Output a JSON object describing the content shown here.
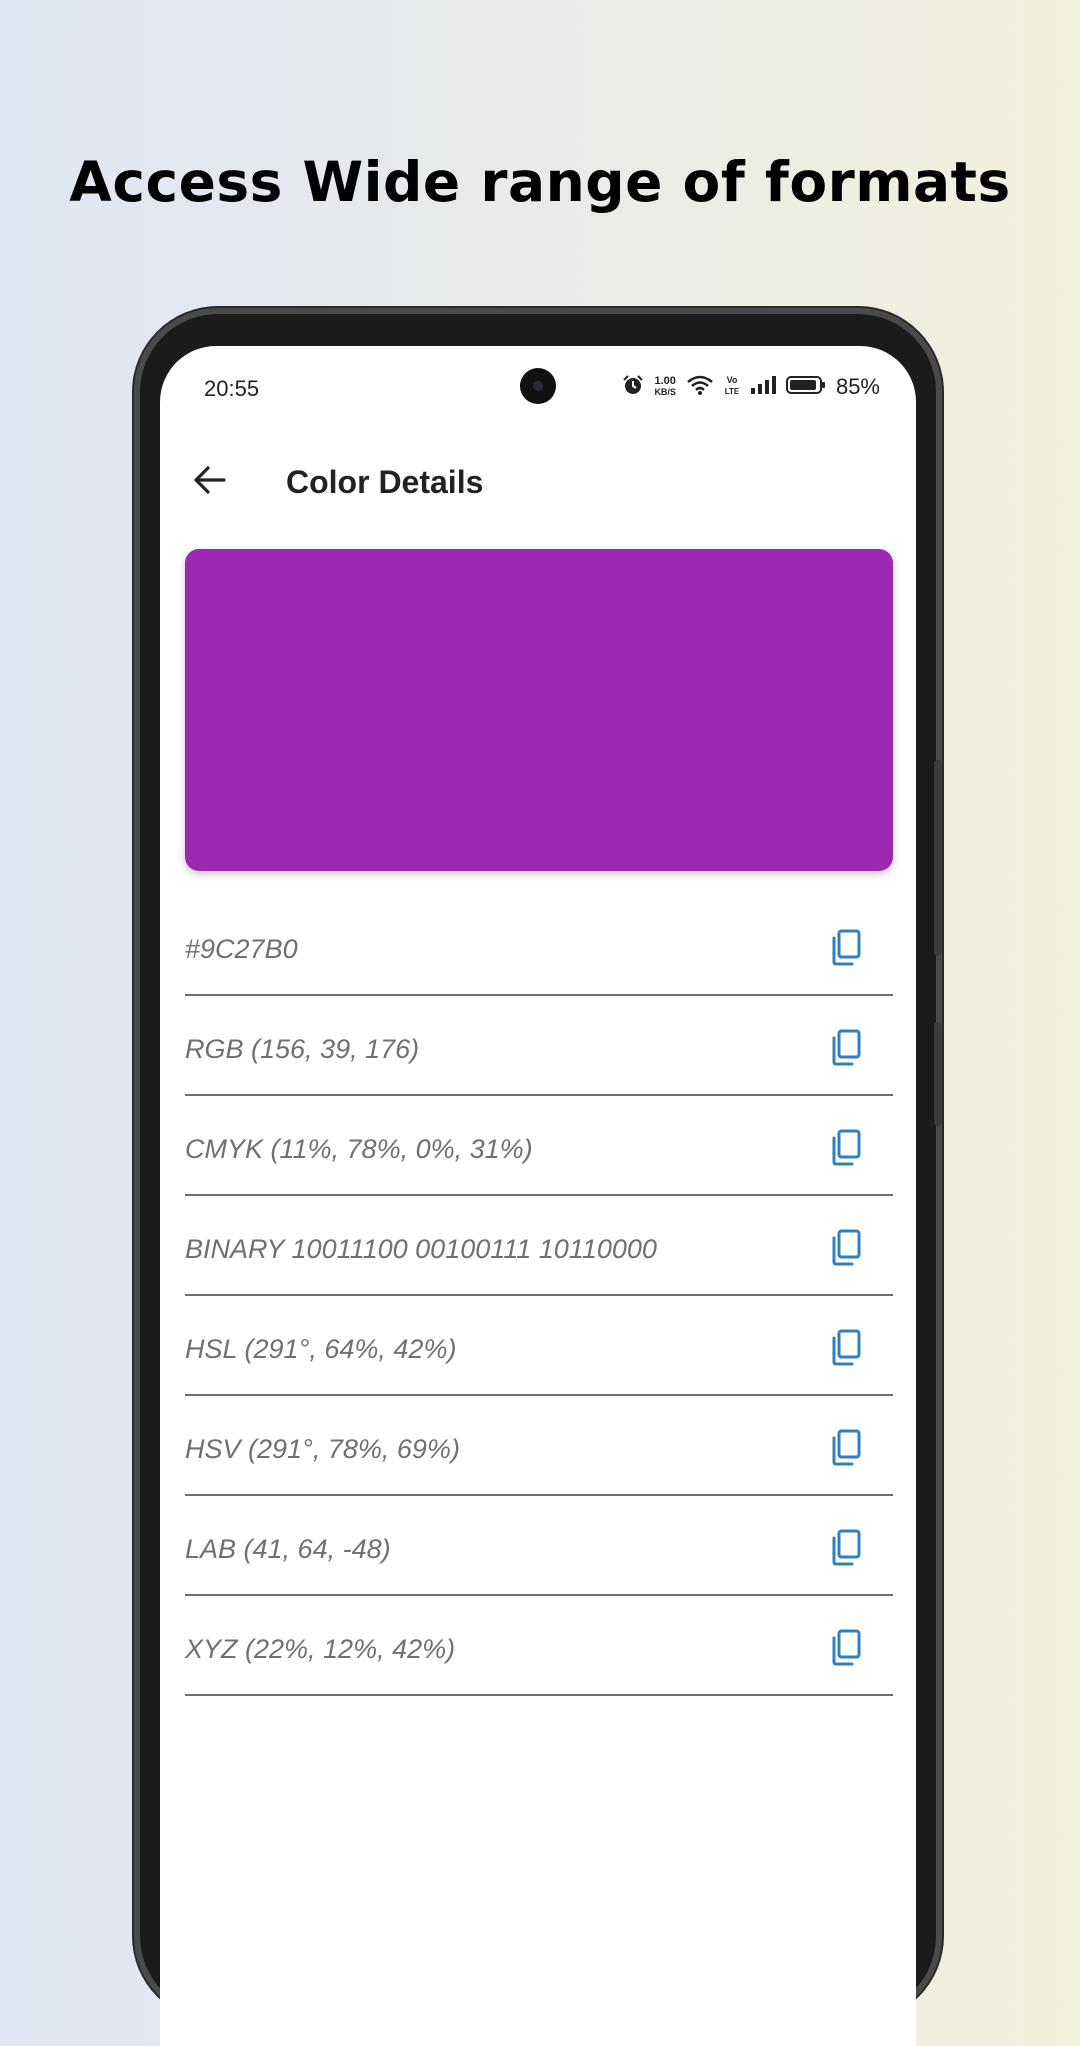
{
  "headline": "Access Wide range of formats",
  "status_bar": {
    "time": "20:55",
    "net_speed_value": "1.00",
    "net_speed_unit": "KB/S",
    "volte": "Vo LTE",
    "battery": "85%"
  },
  "app_bar": {
    "title": "Color Details",
    "back_icon": "arrow-left-icon"
  },
  "color": {
    "swatch_hex": "#9C27B0"
  },
  "formats": [
    {
      "label": "#9C27B0",
      "icon": "copy-icon"
    },
    {
      "label": "RGB (156, 39, 176)",
      "icon": "copy-icon"
    },
    {
      "label": "CMYK (11%, 78%, 0%, 31%)",
      "icon": "copy-icon"
    },
    {
      "label": "BINARY 10011100 00100111 10110000",
      "icon": "copy-icon"
    },
    {
      "label": "HSL (291°, 64%, 42%)",
      "icon": "copy-icon"
    },
    {
      "label": "HSV (291°, 78%, 69%)",
      "icon": "copy-icon"
    },
    {
      "label": "LAB (41, 64, -48)",
      "icon": "copy-icon"
    },
    {
      "label": "XYZ (22%, 12%, 42%)",
      "icon": "copy-icon"
    }
  ],
  "colors": {
    "copy_icon": "#2f80c0",
    "divider": "#6e6e6e",
    "format_text": "#707070"
  }
}
